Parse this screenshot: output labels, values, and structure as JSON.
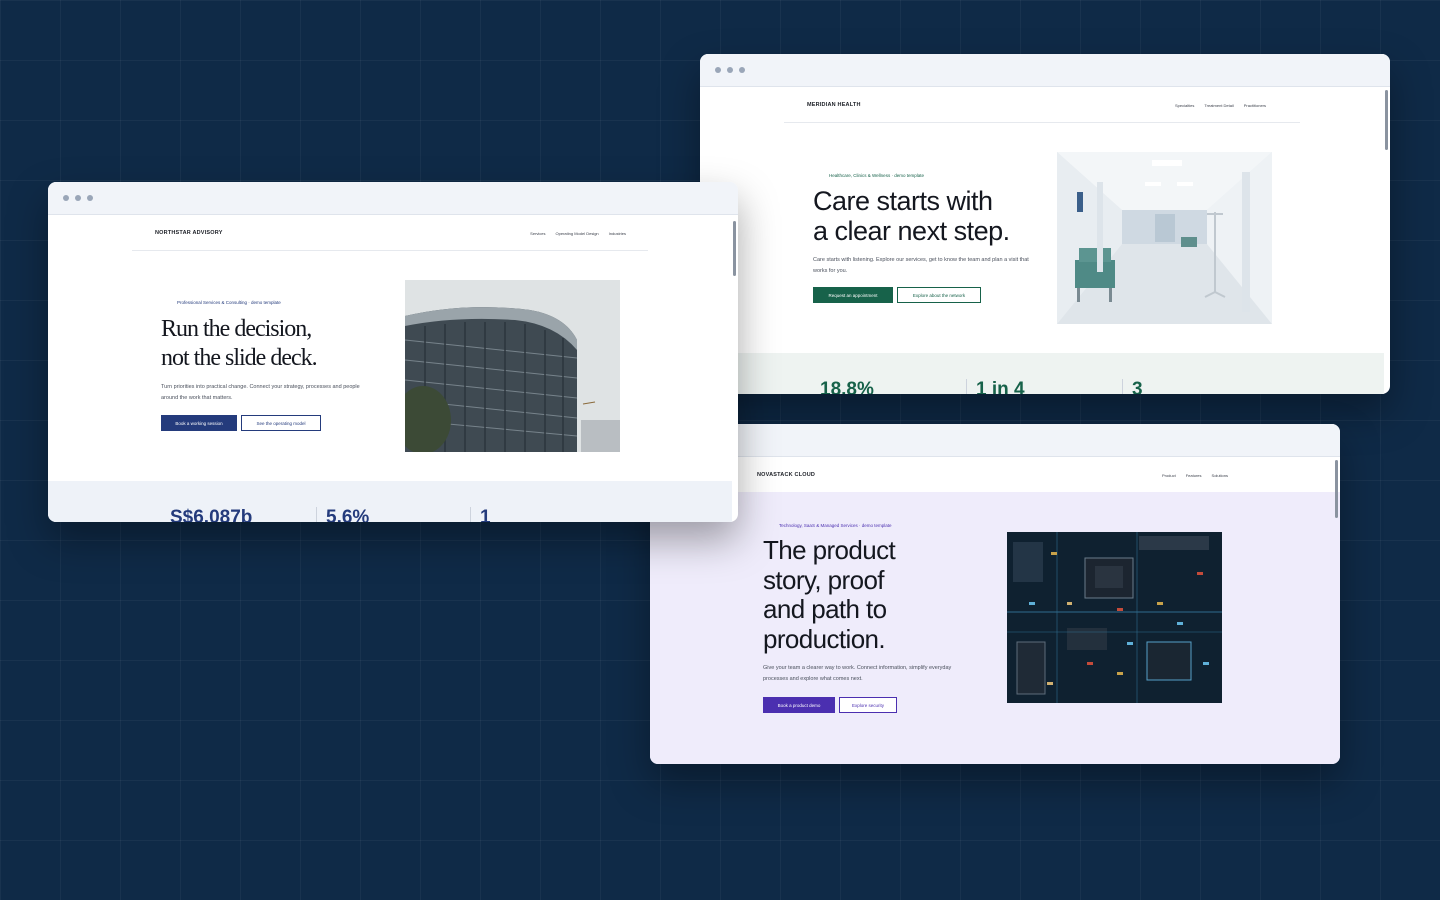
{
  "northstar": {
    "brand": "NORTHSTAR ADVISORY",
    "nav": [
      "Services",
      "Operating Model Design",
      "Industries"
    ],
    "eyebrow": "Professional Services & Consulting · demo template",
    "headline_line1": "Run the decision,",
    "headline_line2": "not the slide deck.",
    "lead": "Turn priorities into practical change. Connect your strategy, processes and people around the work that matters.",
    "primary_button": "Book a working session",
    "secondary_button": "See the operating model",
    "stats": [
      "S$6.087b",
      "5.6%",
      "1"
    ],
    "accent": "#243b7c"
  },
  "meridian": {
    "brand": "MERIDIAN HEALTH",
    "nav": [
      "Specialties",
      "Treatment Detail",
      "Practitioners"
    ],
    "eyebrow": "Healthcare, Clinics & Wellness · demo template",
    "headline_line1": "Care starts with",
    "headline_line2": "a clear next step.",
    "lead": "Care starts with listening. Explore our services, get to know the team and plan a visit that works for you.",
    "primary_button": "Request an appointment",
    "secondary_button": "Explore about the network",
    "stats": [
      "18.8%",
      "1 in 4",
      "3"
    ],
    "accent": "#17624a"
  },
  "novastack": {
    "brand": "NOVASTACK CLOUD",
    "nav": [
      "Product",
      "Features",
      "Solutions"
    ],
    "eyebrow": "Technology, SaaS & Managed Services · demo template",
    "headline_lines": [
      "The product",
      "story, proof",
      "and path to",
      "production."
    ],
    "lead": "Give your team a clearer way to work. Connect information, simplify everyday processes and explore what comes next.",
    "primary_button": "Book a product demo",
    "secondary_button": "Explore security",
    "accent": "#4b2fb0"
  }
}
